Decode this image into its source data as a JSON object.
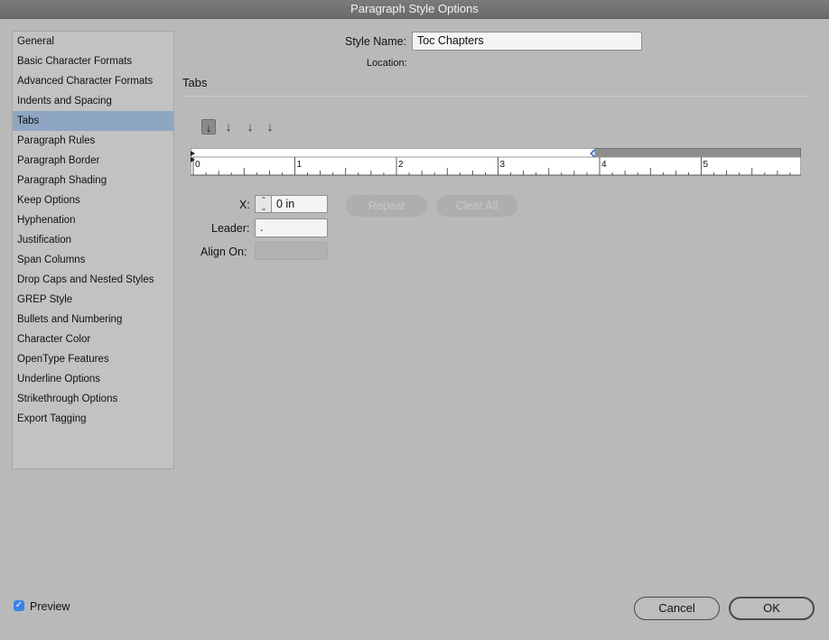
{
  "window": {
    "title": "Paragraph Style Options"
  },
  "sidebar": {
    "selected_index": 4,
    "items": [
      {
        "label": "General"
      },
      {
        "label": "Basic Character Formats"
      },
      {
        "label": "Advanced Character Formats"
      },
      {
        "label": "Indents and Spacing"
      },
      {
        "label": "Tabs"
      },
      {
        "label": "Paragraph Rules"
      },
      {
        "label": "Paragraph Border"
      },
      {
        "label": "Paragraph Shading"
      },
      {
        "label": "Keep Options"
      },
      {
        "label": "Hyphenation"
      },
      {
        "label": "Justification"
      },
      {
        "label": "Span Columns"
      },
      {
        "label": "Drop Caps and Nested Styles"
      },
      {
        "label": "GREP Style"
      },
      {
        "label": "Bullets and Numbering"
      },
      {
        "label": "Character Color"
      },
      {
        "label": "OpenType Features"
      },
      {
        "label": "Underline Options"
      },
      {
        "label": "Strikethrough Options"
      },
      {
        "label": "Export Tagging"
      }
    ]
  },
  "style_name": {
    "label": "Style Name:",
    "value": "Toc Chapters"
  },
  "location": {
    "label": "Location:"
  },
  "section": {
    "title": "Tabs"
  },
  "tab_buttons": [
    {
      "name": "left-justified-tab-icon",
      "glyph": "↓",
      "active": true
    },
    {
      "name": "center-justified-tab-icon",
      "glyph": "↓",
      "active": false
    },
    {
      "name": "right-justified-tab-icon",
      "glyph": "↓",
      "active": false
    },
    {
      "name": "align-to-decimal-tab-icon",
      "glyph": "↓",
      "active": false
    }
  ],
  "ruler": {
    "unit": "in",
    "labels": [
      "0",
      "1",
      "2",
      "3",
      "4",
      "5"
    ],
    "tab_stop_position_in": 3.95
  },
  "x_field": {
    "label": "X:",
    "value": "0 in"
  },
  "leader_field": {
    "label": "Leader:",
    "value": "."
  },
  "align_on_field": {
    "label": "Align On:",
    "value": ""
  },
  "buttons": {
    "repeat": "Repeat",
    "clear_all": "Clear All",
    "cancel": "Cancel",
    "ok": "OK"
  },
  "preview": {
    "label": "Preview",
    "checked": true
  },
  "colors": {
    "selected_row": "#8ea6c2",
    "checkbox": "#3b82e6",
    "tab_stop_marker": "#2f6fc7"
  }
}
